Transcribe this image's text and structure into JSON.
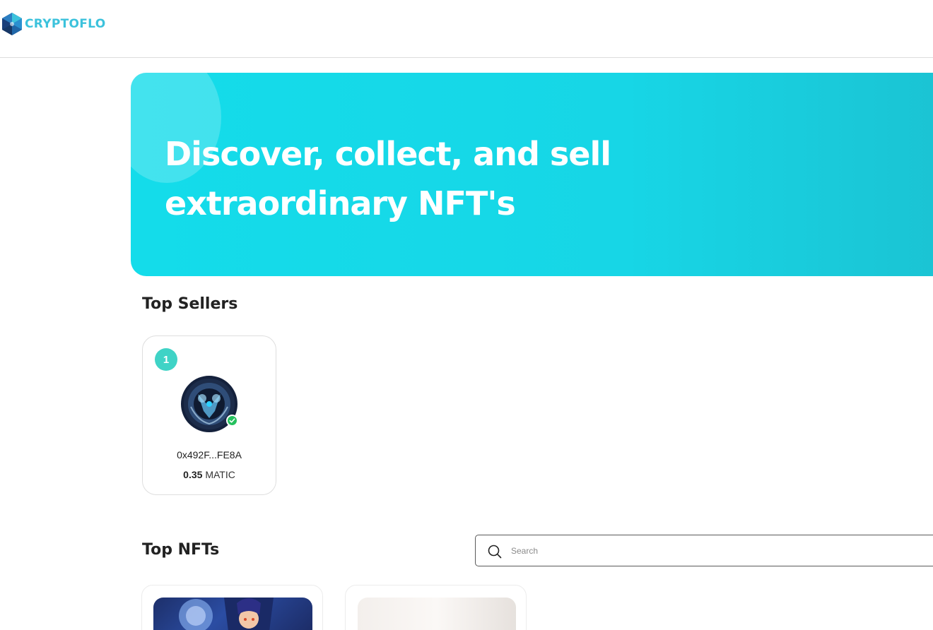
{
  "brand": {
    "name": "CRYPTOFLO"
  },
  "hero": {
    "title_line1": "Discover, collect, and sell",
    "title_line2": "extraordinary NFT's"
  },
  "top_sellers": {
    "title": "Top Sellers",
    "sellers": [
      {
        "rank": "1",
        "address": "0x492F...FE8A",
        "amount": "0.35",
        "currency": "MATIC",
        "verified": true
      }
    ]
  },
  "top_nfts": {
    "title": "Top NFTs",
    "search": {
      "placeholder": "Search",
      "value": ""
    }
  },
  "colors": {
    "brand": "#3cc2dc",
    "hero": "#14dcea",
    "rank_badge": "#3fd3c6",
    "verified": "#25c05e"
  },
  "icons": {
    "search": "search-icon",
    "verified": "check-icon",
    "logo": "logo-icon"
  }
}
